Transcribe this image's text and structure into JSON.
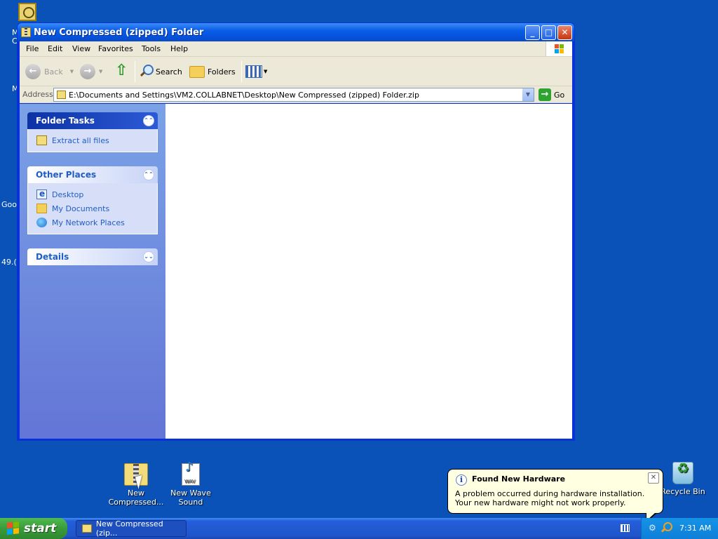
{
  "window": {
    "title": "New Compressed (zipped) Folder",
    "buttons": {
      "minimize": "_",
      "maximize": "□",
      "close": "✕"
    }
  },
  "menu": [
    "File",
    "Edit",
    "View",
    "Favorites",
    "Tools",
    "Help"
  ],
  "toolbar": {
    "back": "Back",
    "search": "Search",
    "folders": "Folders"
  },
  "address": {
    "label": "Address",
    "value": "E:\\Documents and Settings\\VM2.COLLABNET\\Desktop\\New Compressed (zipped) Folder.zip",
    "go": "Go"
  },
  "task_pane": {
    "folder_tasks": {
      "title": "Folder Tasks",
      "items": [
        "Extract all files"
      ]
    },
    "other_places": {
      "title": "Other Places",
      "items": [
        "Desktop",
        "My Documents",
        "My Network Places"
      ]
    },
    "details": {
      "title": "Details"
    }
  },
  "desktop": {
    "clipped_labels": [
      "M",
      "C",
      "M",
      "Goo",
      "49.("
    ],
    "icons": [
      {
        "line1": "New",
        "line2": "Compressed..."
      },
      {
        "line1": "New Wave",
        "line2": "Sound"
      },
      {
        "line1": "Recycle Bin"
      }
    ]
  },
  "balloon": {
    "title": "Found New Hardware",
    "message": "A problem occurred during hardware installation. Your new hardware might not work properly."
  },
  "taskbar": {
    "start": "start",
    "task_button": "New Compressed (zip...",
    "clock": "7:31 AM"
  },
  "colors": {
    "desktop": "#0b52b8",
    "titlebar": "#0a5ee8",
    "task_pane": "#6f8ddc",
    "balloon": "#ffffe1",
    "start_green": "#3a9a3a"
  }
}
